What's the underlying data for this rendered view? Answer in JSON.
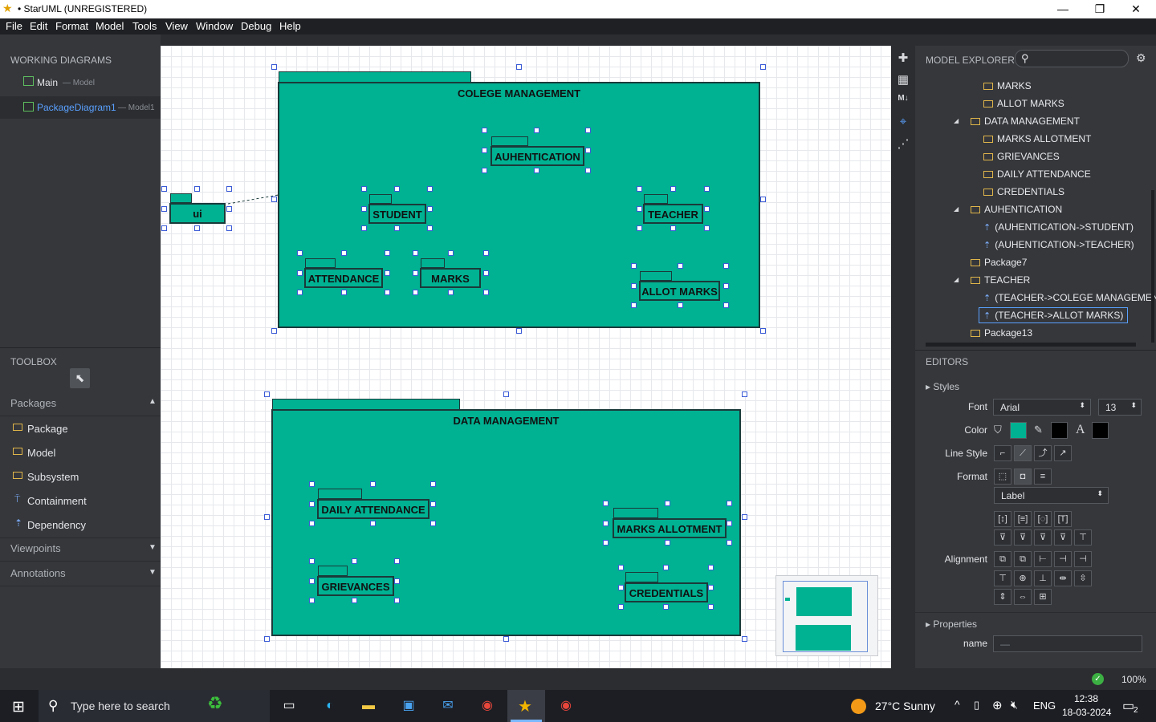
{
  "window": {
    "title": "• StarUML (UNREGISTERED)",
    "min": "—",
    "max": "❐",
    "close": "✕"
  },
  "menu": [
    "File",
    "Edit",
    "Format",
    "Model",
    "Tools",
    "View",
    "Window",
    "Debug",
    "Help"
  ],
  "working_diagrams": {
    "header": "WORKING DIAGRAMS",
    "items": [
      {
        "label": "Main",
        "sub": "— Model"
      },
      {
        "label": "PackageDiagram1",
        "sub": "— Model1"
      }
    ]
  },
  "toolbox": {
    "header": "TOOLBOX",
    "packages_label": "Packages",
    "items": [
      "Package",
      "Model",
      "Subsystem",
      "Containment",
      "Dependency"
    ],
    "viewpoints_label": "Viewpoints",
    "annotations_label": "Annotations"
  },
  "diagram": {
    "college": "COLEGE MANAGEMENT",
    "authentication": "AUHENTICATION",
    "student": "STUDENT",
    "teacher": "TEACHER",
    "attendance": "ATTENDANCE",
    "marks": "MARKS",
    "allot_marks": "ALLOT MARKS",
    "ui": "ui",
    "data_mgmt": "DATA MANAGEMENT",
    "daily_att": "DAILY ATTENDANCE",
    "marks_allot": "MARKS ALLOTMENT",
    "grievances": "GRIEVANCES",
    "credentials": "CREDENTIALS"
  },
  "model_explorer": {
    "header": "MODEL EXPLORER",
    "search_placeholder": "",
    "tree": [
      "MARKS",
      "ALLOT MARKS",
      "DATA MANAGEMENT",
      "MARKS ALLOTMENT",
      "GRIEVANCES",
      "DAILY ATTENDANCE",
      "CREDENTIALS",
      "AUHENTICATION",
      "(AUHENTICATION->STUDENT)",
      "(AUHENTICATION->TEACHER)",
      "Package7",
      "TEACHER",
      "(TEACHER->COLEGE MANAGEMENT)",
      "(TEACHER->ALLOT MARKS)",
      "Package13"
    ]
  },
  "editors": {
    "header": "EDITORS",
    "styles": "Styles",
    "font_label": "Font",
    "font_value": "Arial",
    "font_size": "13",
    "color_label": "Color",
    "fill_color": "#00b192",
    "line_color": "#000000",
    "text_color": "#000000",
    "line_style_label": "Line Style",
    "format_label": "Format",
    "format_value": "Label",
    "alignment_label": "Alignment",
    "properties": "Properties",
    "name_label": "name",
    "name_value": "—"
  },
  "status": {
    "zoom": "100%"
  },
  "taskbar": {
    "search_placeholder": "Type here to search",
    "weather": "27°C  Sunny",
    "lang": "ENG",
    "time": "12:38",
    "date": "18-03-2024",
    "notif": "2"
  }
}
